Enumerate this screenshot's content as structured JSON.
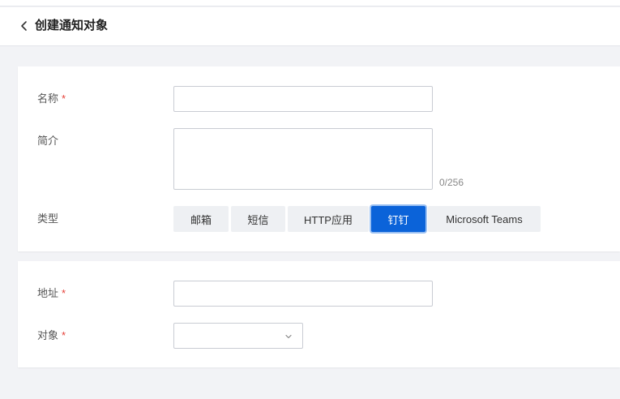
{
  "header": {
    "title": "创建通知对象",
    "back_icon": "chevron-left-icon"
  },
  "basic": {
    "name_label": "名称",
    "name_value": "",
    "desc_label": "简介",
    "desc_value": "",
    "desc_counter": "0/256",
    "type_label": "类型",
    "types": [
      {
        "label": "邮箱",
        "active": false
      },
      {
        "label": "短信",
        "active": false
      },
      {
        "label": "HTTP应用",
        "active": false
      },
      {
        "label": "钉钉",
        "active": true
      },
      {
        "label": "Microsoft Teams",
        "active": false
      }
    ],
    "required_mark": "*"
  },
  "target": {
    "address_label": "地址",
    "address_value": "",
    "object_label": "对象",
    "object_value": "",
    "dropdown_icon": "chevron-down-icon"
  },
  "colors": {
    "accent": "#0b63d9",
    "required": "#e5413a",
    "background": "#f2f3f6"
  }
}
